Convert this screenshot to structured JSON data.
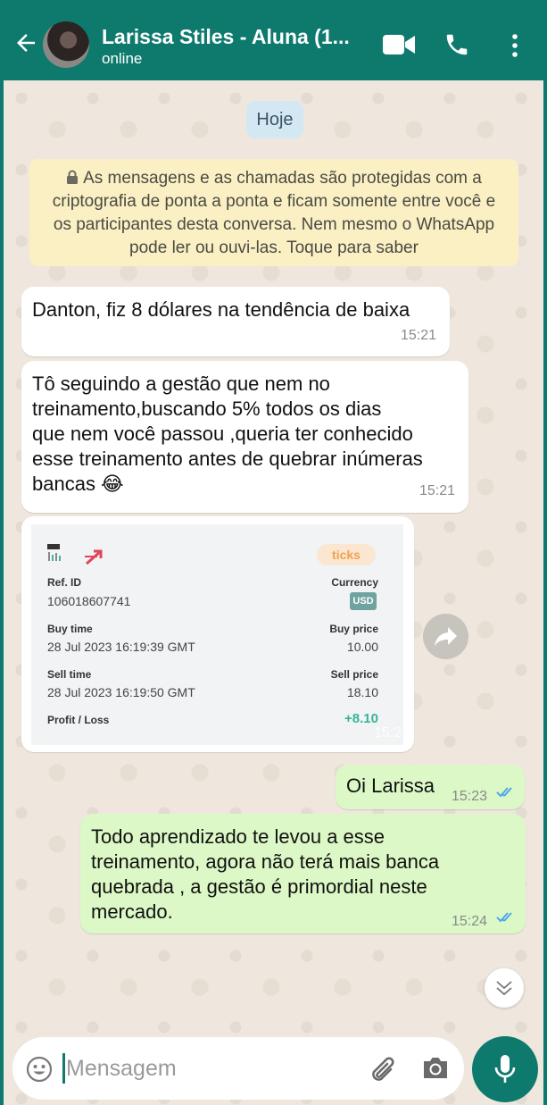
{
  "header": {
    "contact_name": "Larissa Stiles - Aluna (1...",
    "status": "online",
    "icons": [
      "back-arrow-icon",
      "avatar",
      "video-call-icon",
      "phone-icon",
      "more-vertical-icon"
    ],
    "color": "#0e7a6e"
  },
  "date_chip": "Hoje",
  "encryption_notice": "As mensagens e as chamadas são protegidas com a criptografia de ponta a ponta e ficam somente entre você e os participantes desta conversa. Nem mesmo o WhatsApp pode ler ou ouvi-las. Toque para saber",
  "messages": [
    {
      "direction": "in",
      "text": "Danton, fiz 8 dólares na tendência de baixa",
      "time": "15:21"
    },
    {
      "direction": "in",
      "text": "Tô seguindo a gestão que nem no\ntreinamento,buscando 5% todos os dias\nque nem você passou ,queria ter conhecido\nesse treinamento antes de quebrar inúmeras\nbancas 😂",
      "time": "15:21"
    },
    {
      "direction": "out",
      "text": "Oi Larissa",
      "time": "15:23",
      "status": "read"
    },
    {
      "direction": "out",
      "text": "Todo aprendizado te levou a esse\ntreinamento, agora não terá mais banca\nquebrada , a gestão é primordial neste\nmercado.",
      "time": "15:24",
      "status": "read"
    }
  ],
  "receipt": {
    "badge": "ticks",
    "ref_id_label": "Ref. ID",
    "ref_id": "106018607741",
    "currency_label": "Currency",
    "currency": "USD",
    "buy_time_label": "Buy time",
    "buy_time": "28 Jul 2023 16:19:39 GMT",
    "buy_price_label": "Buy price",
    "buy_price": "10.00",
    "sell_time_label": "Sell time",
    "sell_time": "28 Jul 2023 16:19:50 GMT",
    "sell_price_label": "Sell price",
    "sell_price": "18.10",
    "profit_label": "Profit / Loss",
    "profit": "+8.10",
    "time": "15:2"
  },
  "composer": {
    "placeholder": "Mensagem",
    "icons": [
      "emoji-icon",
      "attach-icon",
      "camera-icon",
      "mic-icon"
    ]
  }
}
